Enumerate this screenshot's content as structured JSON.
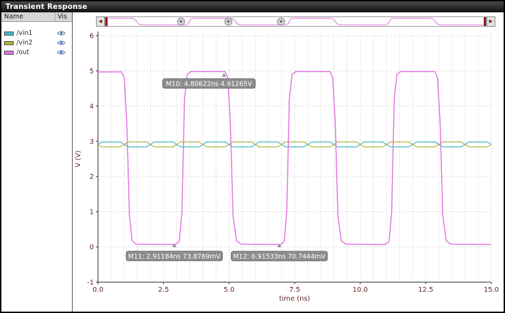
{
  "window": {
    "title": "Transient Response"
  },
  "sidebar": {
    "columns": {
      "name": "Name",
      "vis": "Vis"
    },
    "signals": [
      {
        "label": "/vin1",
        "color": "#3db8c8",
        "visible": true
      },
      {
        "label": "/vin2",
        "color": "#b0b43c",
        "visible": true
      },
      {
        "label": "/out",
        "color": "#e272e2",
        "visible": true
      }
    ]
  },
  "overview": {
    "left_arrow": "◀",
    "right_arrow": "▶",
    "accent_color": "#8b1a1a"
  },
  "markers": [
    {
      "id": "M10",
      "label": "M10: 4.80622ns 4.91265V",
      "x_ns": 4.80622,
      "y_v": 4.91265
    },
    {
      "id": "M11",
      "label": "M11: 2.91184ns 73.8769mV",
      "x_ns": 2.91184,
      "y_v": 0.0738769
    },
    {
      "id": "M12",
      "label": "M12: 6.91533ns 70.7444mV",
      "x_ns": 6.91533,
      "y_v": 0.0707444
    }
  ],
  "colors": {
    "grid": "#bdbdbd",
    "axis_text": "#5c1f1f",
    "axis_line": "#222222",
    "marker_box": "#8c8c8c"
  },
  "chart_data": {
    "type": "line",
    "title": "Transient Response",
    "xlabel": "time (ns)",
    "ylabel": "V (V)",
    "xlim": [
      0,
      15
    ],
    "ylim": [
      -1,
      6
    ],
    "xticks": [
      0,
      2.5,
      5,
      7.5,
      10,
      12.5,
      15
    ],
    "xtick_labels": [
      "0.0",
      "2.5",
      "5.0",
      "7.5",
      "10.0",
      "12.5",
      "15.0"
    ],
    "yticks": [
      -1,
      0,
      1,
      2,
      3,
      4,
      5,
      6
    ],
    "ytick_labels": [
      "-1",
      "0",
      "1",
      "2",
      "3",
      "4",
      "5",
      "6"
    ],
    "grid": {
      "x_step": 0.5,
      "y_step": 1,
      "style": "dotted"
    },
    "legend_position": "left-panel",
    "series": [
      {
        "name": "/vin1",
        "color": "#3db8c8",
        "width": 1.2,
        "points": [
          [
            0,
            2.91
          ],
          [
            0.15,
            2.98
          ],
          [
            0.85,
            2.98
          ],
          [
            1,
            2.91
          ],
          [
            1.15,
            2.84
          ],
          [
            1.85,
            2.84
          ],
          [
            2,
            2.91
          ],
          [
            2.15,
            2.98
          ],
          [
            2.85,
            2.98
          ],
          [
            3,
            2.91
          ],
          [
            3.15,
            2.84
          ],
          [
            3.85,
            2.84
          ],
          [
            4,
            2.91
          ],
          [
            4.15,
            2.98
          ],
          [
            4.85,
            2.98
          ],
          [
            5,
            2.91
          ],
          [
            5.15,
            2.84
          ],
          [
            5.85,
            2.84
          ],
          [
            6,
            2.91
          ],
          [
            6.15,
            2.98
          ],
          [
            6.85,
            2.98
          ],
          [
            7,
            2.91
          ],
          [
            7.15,
            2.84
          ],
          [
            7.85,
            2.84
          ],
          [
            8,
            2.91
          ],
          [
            8.15,
            2.98
          ],
          [
            8.85,
            2.98
          ],
          [
            9,
            2.91
          ],
          [
            9.15,
            2.84
          ],
          [
            9.85,
            2.84
          ],
          [
            10,
            2.91
          ],
          [
            10.15,
            2.98
          ],
          [
            10.85,
            2.98
          ],
          [
            11,
            2.91
          ],
          [
            11.15,
            2.84
          ],
          [
            11.85,
            2.84
          ],
          [
            12,
            2.91
          ],
          [
            12.15,
            2.98
          ],
          [
            12.85,
            2.98
          ],
          [
            13,
            2.91
          ],
          [
            13.15,
            2.84
          ],
          [
            13.85,
            2.84
          ],
          [
            14,
            2.91
          ],
          [
            14.15,
            2.98
          ],
          [
            14.85,
            2.98
          ],
          [
            15,
            2.91
          ]
        ]
      },
      {
        "name": "/vin2",
        "color": "#b0b43c",
        "width": 1.2,
        "points": [
          [
            0,
            2.91
          ],
          [
            0.15,
            2.84
          ],
          [
            0.85,
            2.84
          ],
          [
            1,
            2.91
          ],
          [
            1.15,
            2.98
          ],
          [
            1.85,
            2.98
          ],
          [
            2,
            2.91
          ],
          [
            2.15,
            2.84
          ],
          [
            2.85,
            2.84
          ],
          [
            3,
            2.91
          ],
          [
            3.15,
            2.98
          ],
          [
            3.85,
            2.98
          ],
          [
            4,
            2.91
          ],
          [
            4.15,
            2.84
          ],
          [
            4.85,
            2.84
          ],
          [
            5,
            2.91
          ],
          [
            5.15,
            2.98
          ],
          [
            5.85,
            2.98
          ],
          [
            6,
            2.91
          ],
          [
            6.15,
            2.84
          ],
          [
            6.85,
            2.84
          ],
          [
            7,
            2.91
          ],
          [
            7.15,
            2.98
          ],
          [
            7.85,
            2.98
          ],
          [
            8,
            2.91
          ],
          [
            8.15,
            2.84
          ],
          [
            8.85,
            2.84
          ],
          [
            9,
            2.91
          ],
          [
            9.15,
            2.98
          ],
          [
            9.85,
            2.98
          ],
          [
            10,
            2.91
          ],
          [
            10.15,
            2.84
          ],
          [
            10.85,
            2.84
          ],
          [
            11,
            2.91
          ],
          [
            11.15,
            2.98
          ],
          [
            11.85,
            2.98
          ],
          [
            12,
            2.91
          ],
          [
            12.15,
            2.84
          ],
          [
            12.85,
            2.84
          ],
          [
            13,
            2.91
          ],
          [
            13.15,
            2.98
          ],
          [
            13.85,
            2.98
          ],
          [
            14,
            2.91
          ],
          [
            14.15,
            2.84
          ],
          [
            14.85,
            2.84
          ],
          [
            15,
            2.91
          ]
        ]
      },
      {
        "name": "/out",
        "color": "#e272e2",
        "width": 1.5,
        "points": [
          [
            0,
            4.97
          ],
          [
            0.9,
            4.97
          ],
          [
            1.0,
            4.8
          ],
          [
            1.1,
            3.5
          ],
          [
            1.2,
            0.9
          ],
          [
            1.3,
            0.18
          ],
          [
            1.45,
            0.08
          ],
          [
            2.95,
            0.07
          ],
          [
            3.1,
            0.15
          ],
          [
            3.2,
            1.0
          ],
          [
            3.3,
            4.2
          ],
          [
            3.4,
            4.9
          ],
          [
            3.55,
            4.98
          ],
          [
            4.85,
            4.98
          ],
          [
            4.95,
            4.8
          ],
          [
            5.05,
            3.5
          ],
          [
            5.15,
            0.9
          ],
          [
            5.28,
            0.18
          ],
          [
            5.45,
            0.08
          ],
          [
            6.95,
            0.07
          ],
          [
            7.1,
            0.15
          ],
          [
            7.2,
            1.0
          ],
          [
            7.3,
            4.2
          ],
          [
            7.4,
            4.9
          ],
          [
            7.55,
            4.98
          ],
          [
            8.85,
            4.98
          ],
          [
            8.95,
            4.8
          ],
          [
            9.05,
            3.5
          ],
          [
            9.15,
            0.9
          ],
          [
            9.28,
            0.18
          ],
          [
            9.45,
            0.08
          ],
          [
            10.95,
            0.07
          ],
          [
            11.1,
            0.15
          ],
          [
            11.2,
            1.0
          ],
          [
            11.3,
            4.2
          ],
          [
            11.4,
            4.9
          ],
          [
            11.55,
            4.98
          ],
          [
            12.85,
            4.98
          ],
          [
            12.95,
            4.8
          ],
          [
            13.05,
            3.5
          ],
          [
            13.15,
            0.9
          ],
          [
            13.28,
            0.18
          ],
          [
            13.45,
            0.08
          ],
          [
            15,
            0.07
          ]
        ]
      }
    ]
  }
}
